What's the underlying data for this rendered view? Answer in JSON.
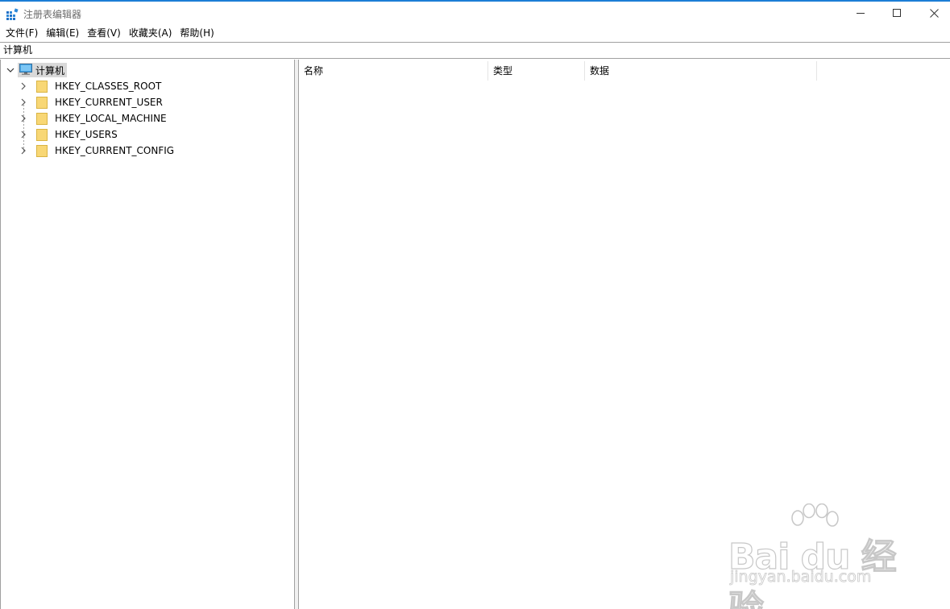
{
  "window": {
    "title": "注册表编辑器",
    "icon": "registry-editor-icon",
    "controls": {
      "minimize": "minimize-icon",
      "maximize": "maximize-icon",
      "close": "close-icon"
    }
  },
  "menu": {
    "items": [
      {
        "label": "文件(F)"
      },
      {
        "label": "编辑(E)"
      },
      {
        "label": "查看(V)"
      },
      {
        "label": "收藏夹(A)"
      },
      {
        "label": "帮助(H)"
      }
    ]
  },
  "address": {
    "value": "计算机"
  },
  "tree": {
    "root": {
      "label": "计算机",
      "icon": "computer-icon",
      "expanded": true,
      "selected": true
    },
    "children": [
      {
        "label": "HKEY_CLASSES_ROOT",
        "icon": "folder-icon"
      },
      {
        "label": "HKEY_CURRENT_USER",
        "icon": "folder-icon"
      },
      {
        "label": "HKEY_LOCAL_MACHINE",
        "icon": "folder-icon"
      },
      {
        "label": "HKEY_USERS",
        "icon": "folder-icon"
      },
      {
        "label": "HKEY_CURRENT_CONFIG",
        "icon": "folder-icon"
      }
    ]
  },
  "list": {
    "columns": [
      {
        "label": "名称"
      },
      {
        "label": "类型"
      },
      {
        "label": "数据"
      }
    ],
    "rows": []
  },
  "watermark": {
    "brand": "Bai du 经验",
    "url": "jingyan.baidu.com"
  },
  "colors": {
    "accent_line": "#1c7ed6",
    "selection": "#d9d9d9",
    "folder": "#f8d775",
    "border": "#a0a0a0"
  }
}
